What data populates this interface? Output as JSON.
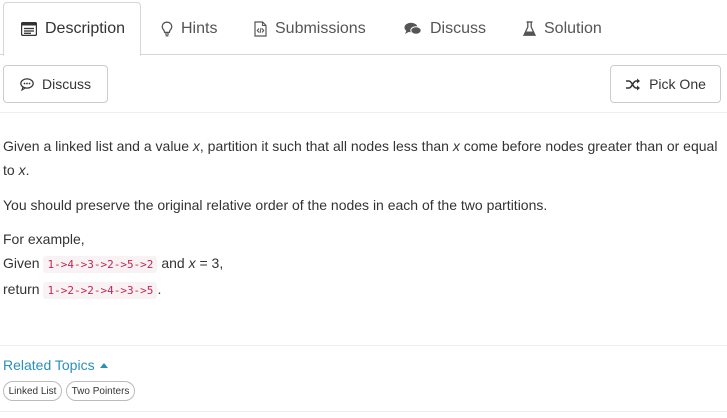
{
  "tabs": [
    {
      "label": "Description",
      "icon": "description-icon",
      "active": true
    },
    {
      "label": "Hints",
      "icon": "lightbulb-icon"
    },
    {
      "label": "Submissions",
      "icon": "code-file-icon"
    },
    {
      "label": "Discuss",
      "icon": "chat-bubbles-icon"
    },
    {
      "label": "Solution",
      "icon": "flask-icon"
    }
  ],
  "toolbar": {
    "discuss_label": "Discuss",
    "pick_one_label": "Pick One"
  },
  "problem": {
    "p1_a": "Given a linked list and a value ",
    "p1_x1": "x",
    "p1_b": ", partition it such that all nodes less than ",
    "p1_x2": "x",
    "p1_c": " come before nodes greater than or equal",
    "p1_d": "to ",
    "p1_x3": "x",
    "p1_e": ".",
    "p2": "You should preserve the original relative order of the nodes in each of the two partitions.",
    "example_intro": "For example,",
    "given_label": "Given ",
    "given_code": "1->4->3->2->5->2",
    "given_and": " and ",
    "given_x": "x",
    "given_eq": " = 3,",
    "return_label": "return ",
    "return_code": "1->2->2->4->3->5",
    "return_end": "."
  },
  "related": {
    "label": "Related Topics",
    "tags": [
      "Linked List",
      "Two Pointers"
    ]
  },
  "colors": {
    "accent": "#2a8fbd",
    "code_text": "#c7254e",
    "code_bg": "#f9f2f4",
    "border": "#cccccc"
  }
}
